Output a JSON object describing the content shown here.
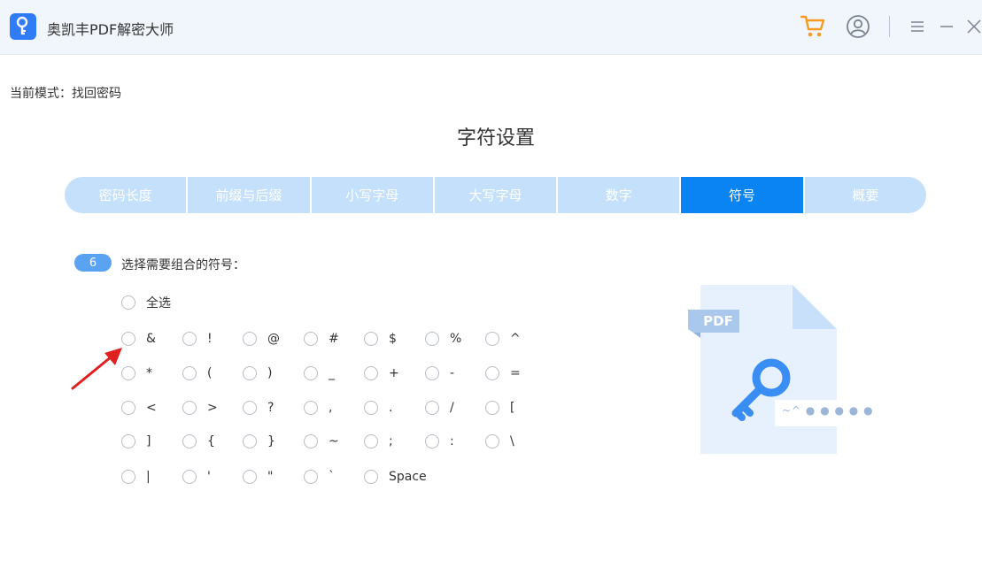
{
  "app": {
    "title": "奥凯丰PDF解密大师"
  },
  "mode": {
    "text": "当前模式：找回密码"
  },
  "page": {
    "title": "字符设置"
  },
  "tabs": [
    {
      "label": "密码长度"
    },
    {
      "label": "前缀与后缀"
    },
    {
      "label": "小写字母"
    },
    {
      "label": "大写字母"
    },
    {
      "label": "数字"
    },
    {
      "label": "符号",
      "active": true
    },
    {
      "label": "概要"
    }
  ],
  "step": {
    "number": "6",
    "text": "选择需要组合的符号："
  },
  "select_all": {
    "label": "全选"
  },
  "symbols": [
    [
      "&",
      "!",
      "@",
      "#",
      "$",
      "%",
      "^"
    ],
    [
      "*",
      "(",
      ")",
      "_",
      "+",
      "-",
      "="
    ],
    [
      "<",
      ">",
      "?",
      ",",
      ".",
      "/",
      "["
    ],
    [
      "]",
      "{",
      "}",
      "~",
      ";",
      ":",
      "\\"
    ],
    [
      "|",
      "'",
      "\"",
      "`",
      "Space"
    ]
  ],
  "illustration": {
    "badge": "PDF",
    "password_mask": "~^ ● ● ● ● ●"
  },
  "colors": {
    "accent": "#0a84f2",
    "tab_inactive": "#c4e0fb",
    "badge": "#5aa3f2",
    "cart": "#f59a23",
    "arrow": "#e02020"
  },
  "icons": {
    "logo": "key-icon",
    "cart": "cart-icon",
    "user": "user-icon",
    "menu": "menu-icon",
    "minimize": "minimize-icon",
    "close": "close-icon"
  }
}
